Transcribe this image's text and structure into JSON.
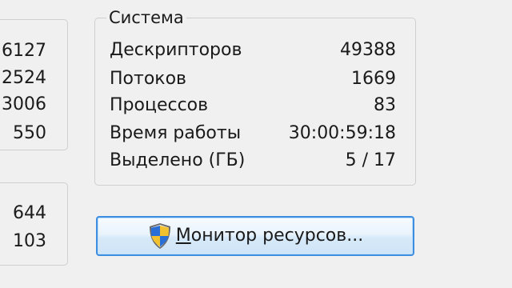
{
  "left_panel_top": {
    "values": [
      "6127",
      "2524",
      "3006",
      "550"
    ]
  },
  "left_panel_bottom": {
    "values": [
      "644",
      "103"
    ]
  },
  "system": {
    "title": "Система",
    "rows": [
      {
        "label": "Дескрипторов",
        "value": "49388"
      },
      {
        "label": "Потоков",
        "value": "1669"
      },
      {
        "label": "Процессов",
        "value": "83"
      },
      {
        "label": "Время работы",
        "value": "30:00:59:18"
      },
      {
        "label": "Выделено (ГБ)",
        "value": "5 / 17"
      }
    ]
  },
  "resource_monitor_button": {
    "label_accel": "М",
    "label_rest": "онитор ресурсов...",
    "icon": "uac-shield-icon"
  },
  "colors": {
    "background": "#f0f0f0",
    "button_border": "#3d8ee0",
    "groupbox_border": "#cfcfcf"
  }
}
